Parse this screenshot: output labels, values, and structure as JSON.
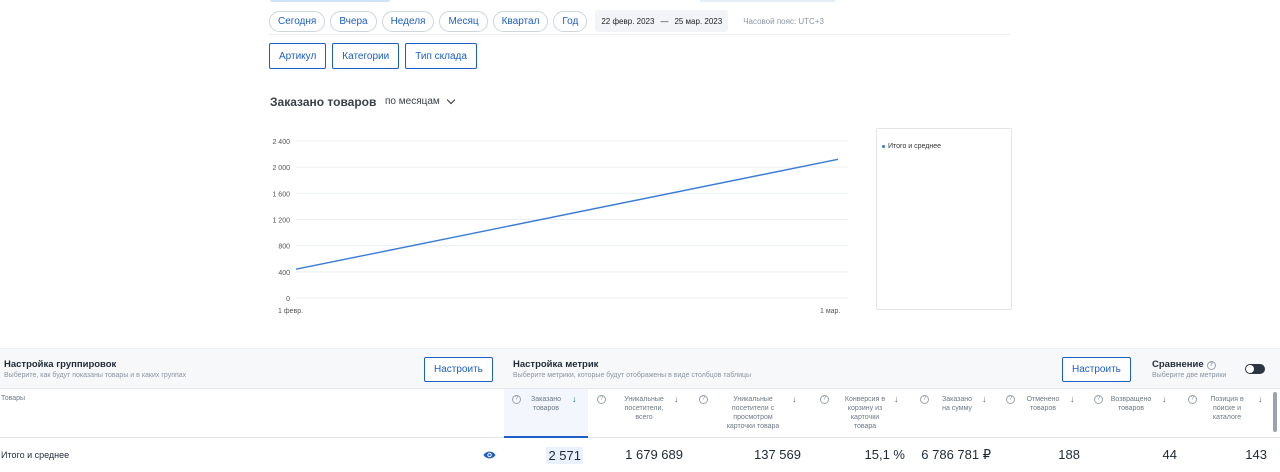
{
  "periods": [
    "Сегодня",
    "Вчера",
    "Неделя",
    "Месяц",
    "Квартал",
    "Год"
  ],
  "date_range": {
    "from": "22 февр. 2023",
    "sep": "—",
    "to": "25 мар. 2023"
  },
  "timezone": "Часовой пояс: UTC+3",
  "group_buttons": [
    "Артикул",
    "Категории",
    "Тип склада"
  ],
  "chart_header": {
    "title": "Заказано товаров",
    "period": "по месяцам"
  },
  "chart_data": {
    "type": "line",
    "x": [
      "1 февр.",
      "1 мар."
    ],
    "series": [
      {
        "name": "Итого и среднее",
        "values": [
          440,
          2120
        ],
        "color": "#3a7bd5"
      }
    ],
    "yticks": [
      "2 400",
      "2 000",
      "1 600",
      "1 200",
      "800",
      "400",
      "0"
    ],
    "ylim": [
      0,
      2400
    ],
    "grid": true,
    "legend": "right"
  },
  "legend": {
    "item": "Итого и среднее"
  },
  "grouping": {
    "title": "Настройка группировок",
    "subtitle": "Выберите, как будут показаны товары и в каких группах",
    "button": "Настроить"
  },
  "metrics": {
    "title": "Настройка метрик",
    "subtitle": "Выберите метрики, которые будут отображены в виде столбцов таблицы",
    "button": "Настроить"
  },
  "comparison": {
    "title": "Сравнение",
    "subtitle": "Выберите две метрики",
    "enabled": false
  },
  "table": {
    "goods_header": "Товары",
    "columns": [
      {
        "l1": "Заказано",
        "l2": "товаров",
        "l3": "",
        "l4": ""
      },
      {
        "l1": "Уникальные",
        "l2": "посетители,",
        "l3": "всего",
        "l4": ""
      },
      {
        "l1": "Уникальные",
        "l2": "посетители с",
        "l3": "просмотром",
        "l4": "карточки товара"
      },
      {
        "l1": "Конверсия в",
        "l2": "корзину из",
        "l3": "карточки",
        "l4": "товара"
      },
      {
        "l1": "Заказано",
        "l2": "на сумму",
        "l3": "",
        "l4": ""
      },
      {
        "l1": "Отменено",
        "l2": "товаров",
        "l3": "",
        "l4": ""
      },
      {
        "l1": "Возвращено",
        "l2": "товаров",
        "l3": "",
        "l4": ""
      },
      {
        "l1": "Позиция в",
        "l2": "поиске и",
        "l3": "каталоге",
        "l4": ""
      }
    ],
    "rows": [
      {
        "label": "Итого и среднее",
        "values": [
          "2 571",
          "1 679 689",
          "137 569",
          "15,1 %",
          "6 786 781 ₽",
          "188",
          "44",
          "143"
        ]
      }
    ]
  }
}
